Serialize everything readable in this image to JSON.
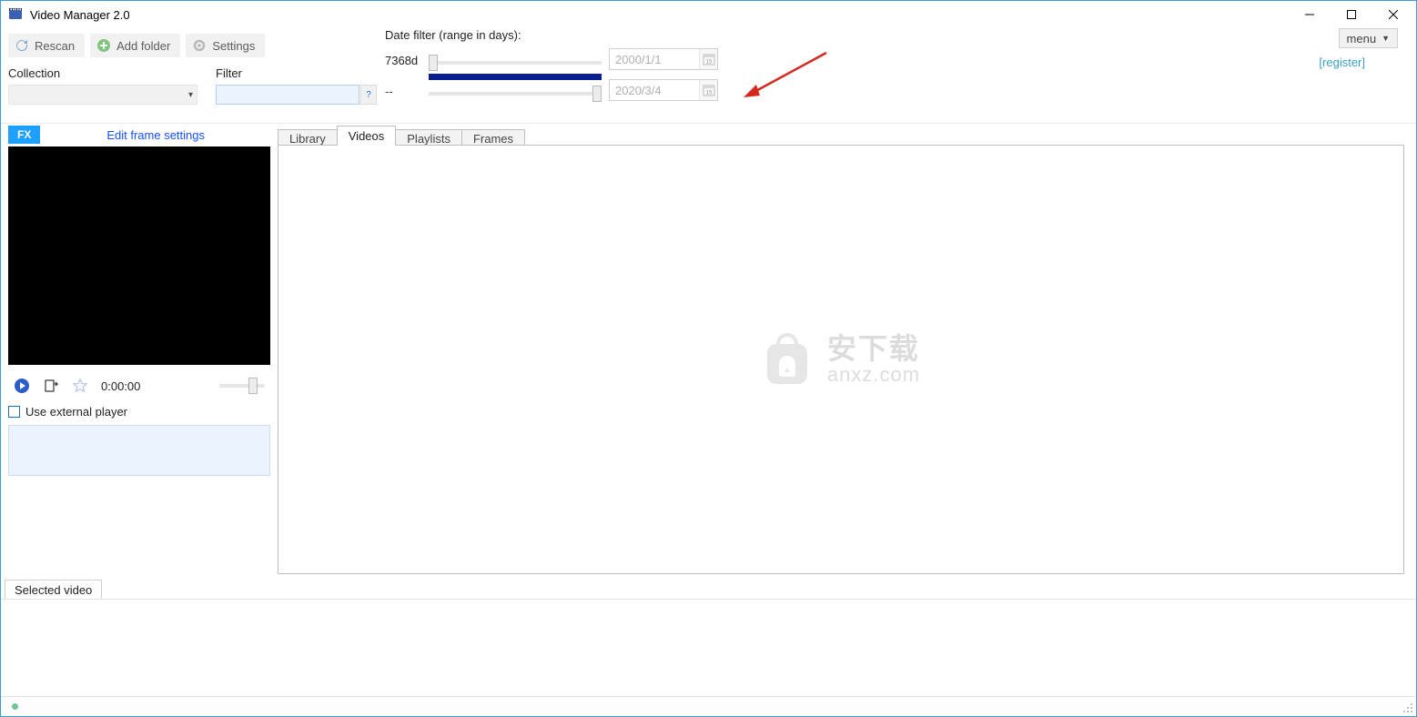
{
  "window": {
    "title": "Video Manager 2.0"
  },
  "toolbar": {
    "rescan": "Rescan",
    "add_folder": "Add folder",
    "settings": "Settings"
  },
  "labels": {
    "collection": "Collection",
    "filter": "Filter",
    "date_filter": "Date filter (range in days):"
  },
  "date_filter": {
    "days_value": "7368d",
    "dashes": "--",
    "date_from": "2000/1/1",
    "date_to": "2020/3/4"
  },
  "right_top": {
    "register": "[register]",
    "menu": "menu"
  },
  "left_panel": {
    "fx": "FX",
    "edit_frame": "Edit frame settings",
    "time": "0:00:00",
    "use_external": "Use external player"
  },
  "tabs": {
    "library": "Library",
    "videos": "Videos",
    "playlists": "Playlists",
    "frames": "Frames",
    "active": "videos"
  },
  "bottom_tab": "Selected video",
  "filter_help": "?",
  "watermark": {
    "line1": "安下载",
    "line2": "anxz.com"
  },
  "collection_value": "",
  "filter_value": ""
}
